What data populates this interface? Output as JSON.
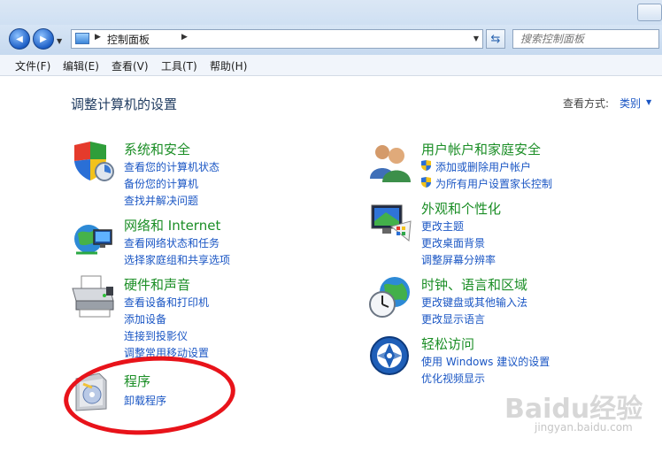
{
  "nav": {
    "back_glyph": "◀",
    "forward_glyph": "▶",
    "address_text": "控制面板",
    "search_placeholder": "搜索控制面板"
  },
  "menu": [
    "文件(F)",
    "编辑(E)",
    "查看(V)",
    "工具(T)",
    "帮助(H)"
  ],
  "header": {
    "title": "调整计算机的设置",
    "view_by_label": "查看方式:",
    "view_by_value": "类别"
  },
  "categories": [
    {
      "title": "系统和安全",
      "icon": "shield-security-icon",
      "links": [
        "查看您的计算机状态",
        "备份您的计算机",
        "查找并解决问题"
      ]
    },
    {
      "title": "网络和 Internet",
      "icon": "network-globe-icon",
      "links": [
        "查看网络状态和任务",
        "选择家庭组和共享选项"
      ]
    },
    {
      "title": "硬件和声音",
      "icon": "printer-icon",
      "links": [
        "查看设备和打印机",
        "添加设备",
        "连接到投影仪",
        "调整常用移动设置"
      ]
    },
    {
      "title": "程序",
      "icon": "programs-box-icon",
      "links": [
        "卸载程序"
      ]
    },
    {
      "title": "用户帐户和家庭安全",
      "icon": "users-icon",
      "links": [
        "添加或删除用户帐户",
        "为所有用户设置家长控制"
      ]
    },
    {
      "title": "外观和个性化",
      "icon": "monitor-palette-icon",
      "links": [
        "更改主题",
        "更改桌面背景",
        "调整屏幕分辨率"
      ]
    },
    {
      "title": "时钟、语言和区域",
      "icon": "clock-globe-icon",
      "links": [
        "更改键盘或其他输入法",
        "更改显示语言"
      ]
    },
    {
      "title": "轻松访问",
      "icon": "ease-of-access-icon",
      "links": [
        "使用 Windows 建议的设置",
        "优化视频显示"
      ]
    }
  ],
  "watermark": {
    "brand": "Baidu经验",
    "url": "jingyan.baidu.com"
  },
  "colors": {
    "category_title": "#1b8e26",
    "link": "#1a56c4",
    "annotation_circle": "#e8131a"
  }
}
